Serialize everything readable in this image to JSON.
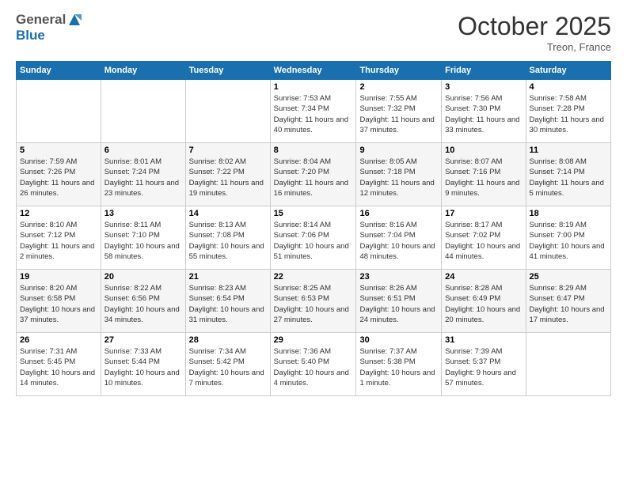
{
  "header": {
    "logo_line1": "General",
    "logo_line2": "Blue",
    "month": "October 2025",
    "location": "Treon, France"
  },
  "days_of_week": [
    "Sunday",
    "Monday",
    "Tuesday",
    "Wednesday",
    "Thursday",
    "Friday",
    "Saturday"
  ],
  "weeks": [
    [
      {
        "day": "",
        "info": ""
      },
      {
        "day": "",
        "info": ""
      },
      {
        "day": "",
        "info": ""
      },
      {
        "day": "1",
        "info": "Sunrise: 7:53 AM\nSunset: 7:34 PM\nDaylight: 11 hours and 40 minutes."
      },
      {
        "day": "2",
        "info": "Sunrise: 7:55 AM\nSunset: 7:32 PM\nDaylight: 11 hours and 37 minutes."
      },
      {
        "day": "3",
        "info": "Sunrise: 7:56 AM\nSunset: 7:30 PM\nDaylight: 11 hours and 33 minutes."
      },
      {
        "day": "4",
        "info": "Sunrise: 7:58 AM\nSunset: 7:28 PM\nDaylight: 11 hours and 30 minutes."
      }
    ],
    [
      {
        "day": "5",
        "info": "Sunrise: 7:59 AM\nSunset: 7:26 PM\nDaylight: 11 hours and 26 minutes."
      },
      {
        "day": "6",
        "info": "Sunrise: 8:01 AM\nSunset: 7:24 PM\nDaylight: 11 hours and 23 minutes."
      },
      {
        "day": "7",
        "info": "Sunrise: 8:02 AM\nSunset: 7:22 PM\nDaylight: 11 hours and 19 minutes."
      },
      {
        "day": "8",
        "info": "Sunrise: 8:04 AM\nSunset: 7:20 PM\nDaylight: 11 hours and 16 minutes."
      },
      {
        "day": "9",
        "info": "Sunrise: 8:05 AM\nSunset: 7:18 PM\nDaylight: 11 hours and 12 minutes."
      },
      {
        "day": "10",
        "info": "Sunrise: 8:07 AM\nSunset: 7:16 PM\nDaylight: 11 hours and 9 minutes."
      },
      {
        "day": "11",
        "info": "Sunrise: 8:08 AM\nSunset: 7:14 PM\nDaylight: 11 hours and 5 minutes."
      }
    ],
    [
      {
        "day": "12",
        "info": "Sunrise: 8:10 AM\nSunset: 7:12 PM\nDaylight: 11 hours and 2 minutes."
      },
      {
        "day": "13",
        "info": "Sunrise: 8:11 AM\nSunset: 7:10 PM\nDaylight: 10 hours and 58 minutes."
      },
      {
        "day": "14",
        "info": "Sunrise: 8:13 AM\nSunset: 7:08 PM\nDaylight: 10 hours and 55 minutes."
      },
      {
        "day": "15",
        "info": "Sunrise: 8:14 AM\nSunset: 7:06 PM\nDaylight: 10 hours and 51 minutes."
      },
      {
        "day": "16",
        "info": "Sunrise: 8:16 AM\nSunset: 7:04 PM\nDaylight: 10 hours and 48 minutes."
      },
      {
        "day": "17",
        "info": "Sunrise: 8:17 AM\nSunset: 7:02 PM\nDaylight: 10 hours and 44 minutes."
      },
      {
        "day": "18",
        "info": "Sunrise: 8:19 AM\nSunset: 7:00 PM\nDaylight: 10 hours and 41 minutes."
      }
    ],
    [
      {
        "day": "19",
        "info": "Sunrise: 8:20 AM\nSunset: 6:58 PM\nDaylight: 10 hours and 37 minutes."
      },
      {
        "day": "20",
        "info": "Sunrise: 8:22 AM\nSunset: 6:56 PM\nDaylight: 10 hours and 34 minutes."
      },
      {
        "day": "21",
        "info": "Sunrise: 8:23 AM\nSunset: 6:54 PM\nDaylight: 10 hours and 31 minutes."
      },
      {
        "day": "22",
        "info": "Sunrise: 8:25 AM\nSunset: 6:53 PM\nDaylight: 10 hours and 27 minutes."
      },
      {
        "day": "23",
        "info": "Sunrise: 8:26 AM\nSunset: 6:51 PM\nDaylight: 10 hours and 24 minutes."
      },
      {
        "day": "24",
        "info": "Sunrise: 8:28 AM\nSunset: 6:49 PM\nDaylight: 10 hours and 20 minutes."
      },
      {
        "day": "25",
        "info": "Sunrise: 8:29 AM\nSunset: 6:47 PM\nDaylight: 10 hours and 17 minutes."
      }
    ],
    [
      {
        "day": "26",
        "info": "Sunrise: 7:31 AM\nSunset: 5:45 PM\nDaylight: 10 hours and 14 minutes."
      },
      {
        "day": "27",
        "info": "Sunrise: 7:33 AM\nSunset: 5:44 PM\nDaylight: 10 hours and 10 minutes."
      },
      {
        "day": "28",
        "info": "Sunrise: 7:34 AM\nSunset: 5:42 PM\nDaylight: 10 hours and 7 minutes."
      },
      {
        "day": "29",
        "info": "Sunrise: 7:36 AM\nSunset: 5:40 PM\nDaylight: 10 hours and 4 minutes."
      },
      {
        "day": "30",
        "info": "Sunrise: 7:37 AM\nSunset: 5:38 PM\nDaylight: 10 hours and 1 minute."
      },
      {
        "day": "31",
        "info": "Sunrise: 7:39 AM\nSunset: 5:37 PM\nDaylight: 9 hours and 57 minutes."
      },
      {
        "day": "",
        "info": ""
      }
    ]
  ]
}
